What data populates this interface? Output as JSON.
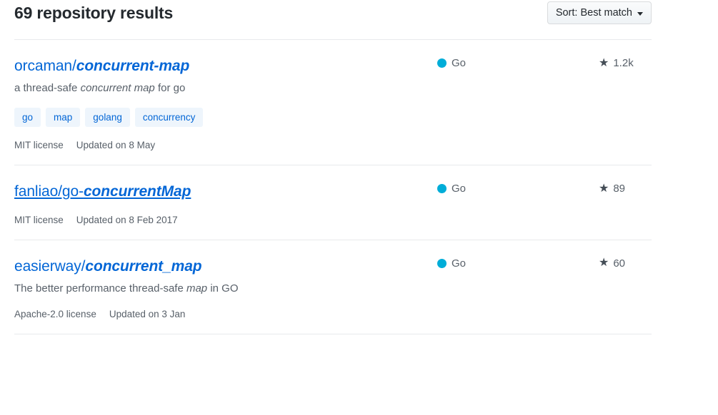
{
  "header": {
    "results_title": "69 repository results",
    "sort": {
      "label": "Sort: Best match",
      "caret_icon": "chevron-down-icon"
    }
  },
  "colors": {
    "link": "#0366d6",
    "go_language_dot": "#00ADD8",
    "star_icon": "#444d56",
    "muted_text": "#586069",
    "divider": "#e8eaec",
    "topic_background": "#eef5fc"
  },
  "repositories": [
    {
      "owner": "orcaman/",
      "match": "concurrent-map",
      "hovered": false,
      "description_prefix": "a thread-safe ",
      "description_match": "concurrent map",
      "description_suffix": " for go",
      "topics": [
        "go",
        "map",
        "golang",
        "concurrency"
      ],
      "license": "MIT license",
      "updated": "Updated on 8 May",
      "language": "Go",
      "stars": "1.2k",
      "star_icon": "star-icon"
    },
    {
      "owner": "fanliao/go-",
      "match": "concurrentMap",
      "hovered": true,
      "description_prefix": "",
      "description_match": "",
      "description_suffix": "",
      "topics": [],
      "license": "MIT license",
      "updated": "Updated on 8 Feb 2017",
      "language": "Go",
      "stars": "89",
      "star_icon": "star-icon"
    },
    {
      "owner": "easierway/",
      "match": "concurrent_map",
      "hovered": false,
      "description_prefix": "The better performance thread-safe ",
      "description_match": "map",
      "description_suffix": " in GO",
      "topics": [],
      "license": "Apache-2.0 license",
      "updated": "Updated on 3 Jan",
      "language": "Go",
      "stars": "60",
      "star_icon": "star-icon"
    }
  ]
}
